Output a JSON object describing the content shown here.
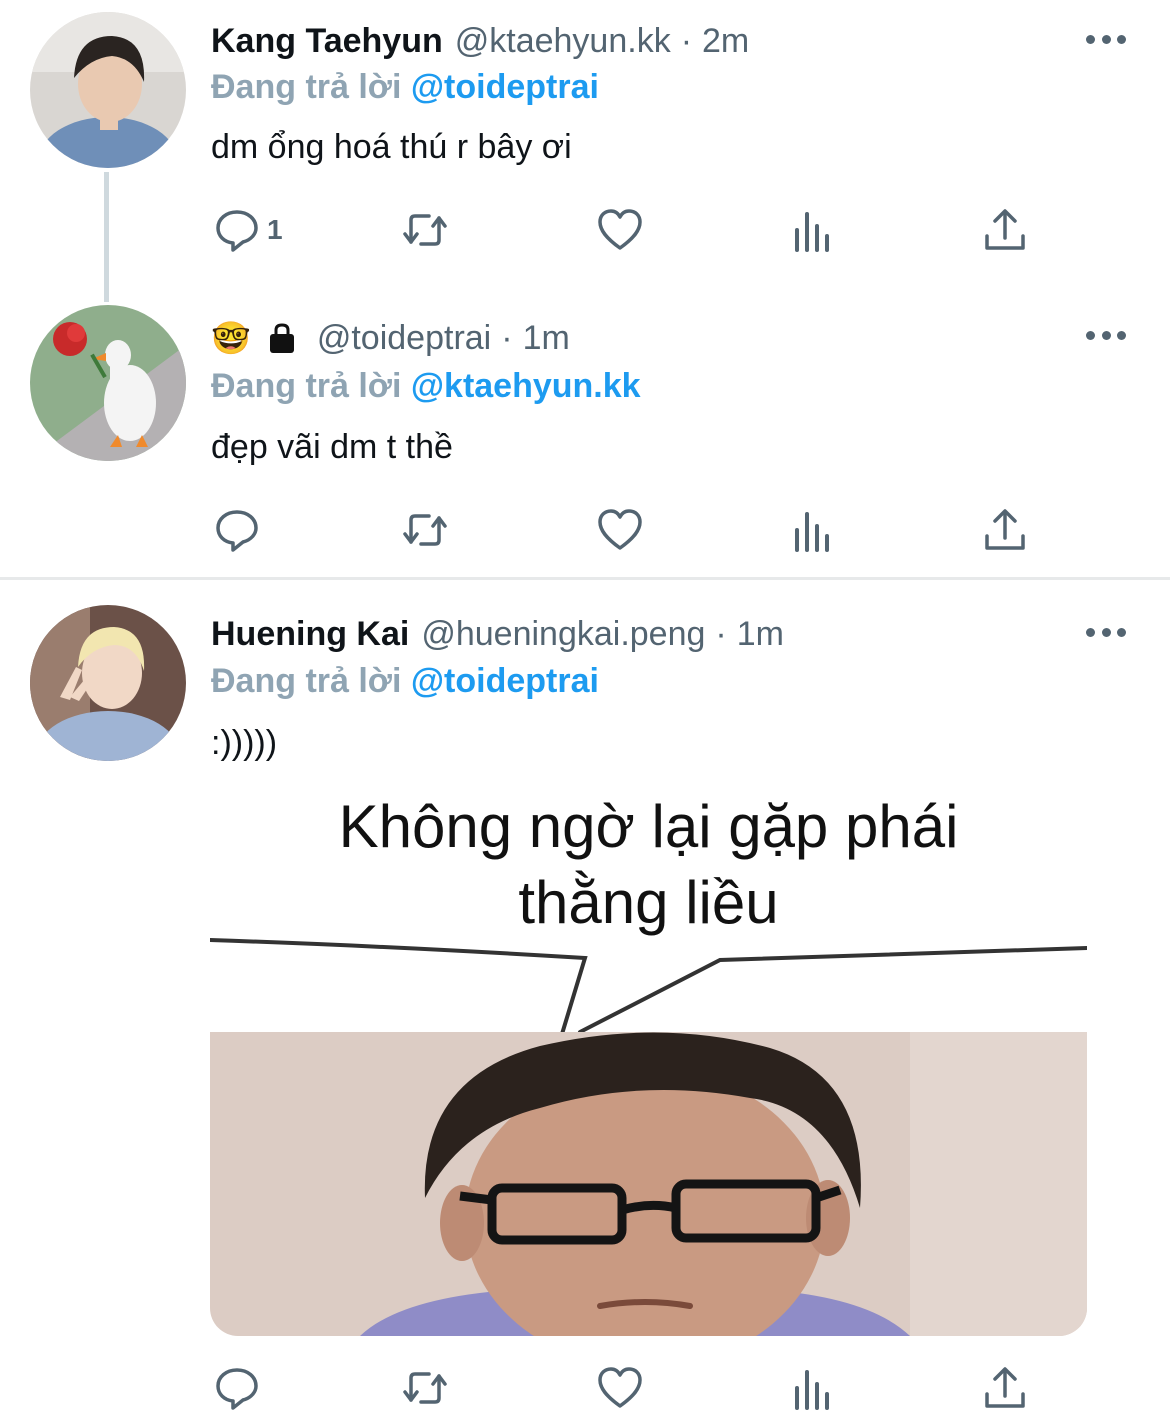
{
  "tweets": [
    {
      "avatar_icon": "profile-photo-man-denim-jacket",
      "name": "Kang Taehyun",
      "handle": "@ktaehyun.kk",
      "separator": "·",
      "time": "2m",
      "reply_label": "Đang trả lời",
      "reply_mention": "@toideptrai",
      "text": "dm ổng hoá thú r bây ơi",
      "reply_count": "1"
    },
    {
      "avatar_icon": "goose-with-rose-avatar",
      "name_emoji": "🤓",
      "lock_icon": "lock-icon",
      "handle": "@toideptrai",
      "separator": "·",
      "time": "1m",
      "reply_label": "Đang trả lời",
      "reply_mention": "@ktaehyun.kk",
      "text": "đẹp vãi dm t thề"
    },
    {
      "avatar_icon": "profile-photo-blond-peace-sign",
      "name": "Huening Kai",
      "handle": "@hueningkai.peng",
      "separator": "·",
      "time": "1m",
      "reply_label": "Đang trả lời",
      "reply_mention": "@toideptrai",
      "text": ":)))))",
      "media": {
        "caption_line1": "Không ngờ lại gặp phái",
        "caption_line2": "thằng liều",
        "image_icon": "meme-man-with-glasses"
      }
    }
  ],
  "icons": {
    "reply": "reply-bubble-icon",
    "retweet": "retweet-icon",
    "like": "heart-icon",
    "views": "analytics-bars-icon",
    "share": "share-upload-icon",
    "more": "more-dots-icon"
  },
  "colors": {
    "mention": "#1d9bf0",
    "reply_label": "#8fa4b3",
    "secondary_text": "#536471",
    "action_icon": "#536471"
  }
}
